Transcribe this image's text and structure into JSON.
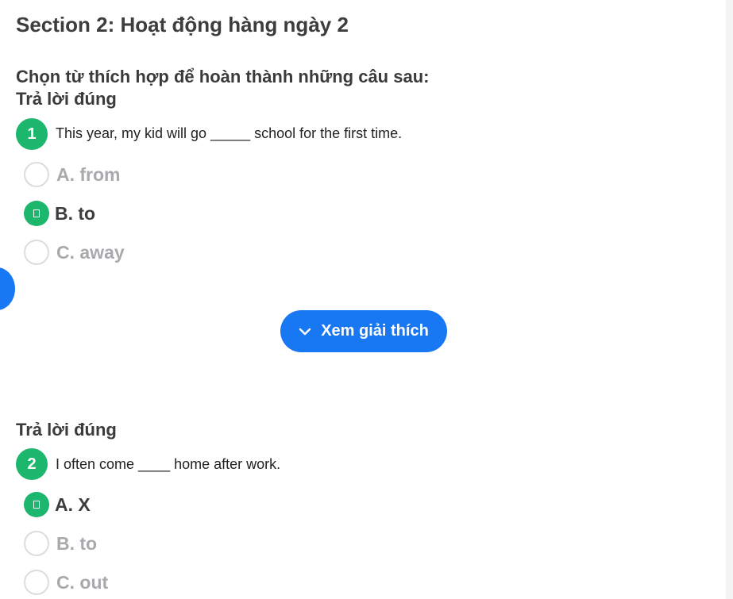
{
  "section": {
    "title": "Section 2: Hoạt động hàng ngày 2",
    "instruction": "Chọn từ thích hợp để hoàn thành những câu sau:"
  },
  "questions": [
    {
      "result_label": "Trả lời đúng",
      "number": "1",
      "text": "This year, my kid will go _____ school for the first time.",
      "options": [
        {
          "label": "A. from",
          "selected": false
        },
        {
          "label": "B. to",
          "selected": true
        },
        {
          "label": "C. away",
          "selected": false
        }
      ],
      "explain_button": "Xem giải thích"
    },
    {
      "result_label": "Trả lời đúng",
      "number": "2",
      "text": "I often come ____ home after work.",
      "options": [
        {
          "label": "A. X",
          "selected": true
        },
        {
          "label": "B. to",
          "selected": false
        },
        {
          "label": "C. out",
          "selected": false
        }
      ]
    }
  ],
  "icons": {
    "explain_button_icon": "chevron-down-icon",
    "selected_option_icon": "check-icon"
  },
  "colors": {
    "correct_green": "#1cb66d",
    "accent_blue": "#1877f2",
    "heading_text": "#3d3d3d",
    "muted_option": "#a9a9ae"
  }
}
